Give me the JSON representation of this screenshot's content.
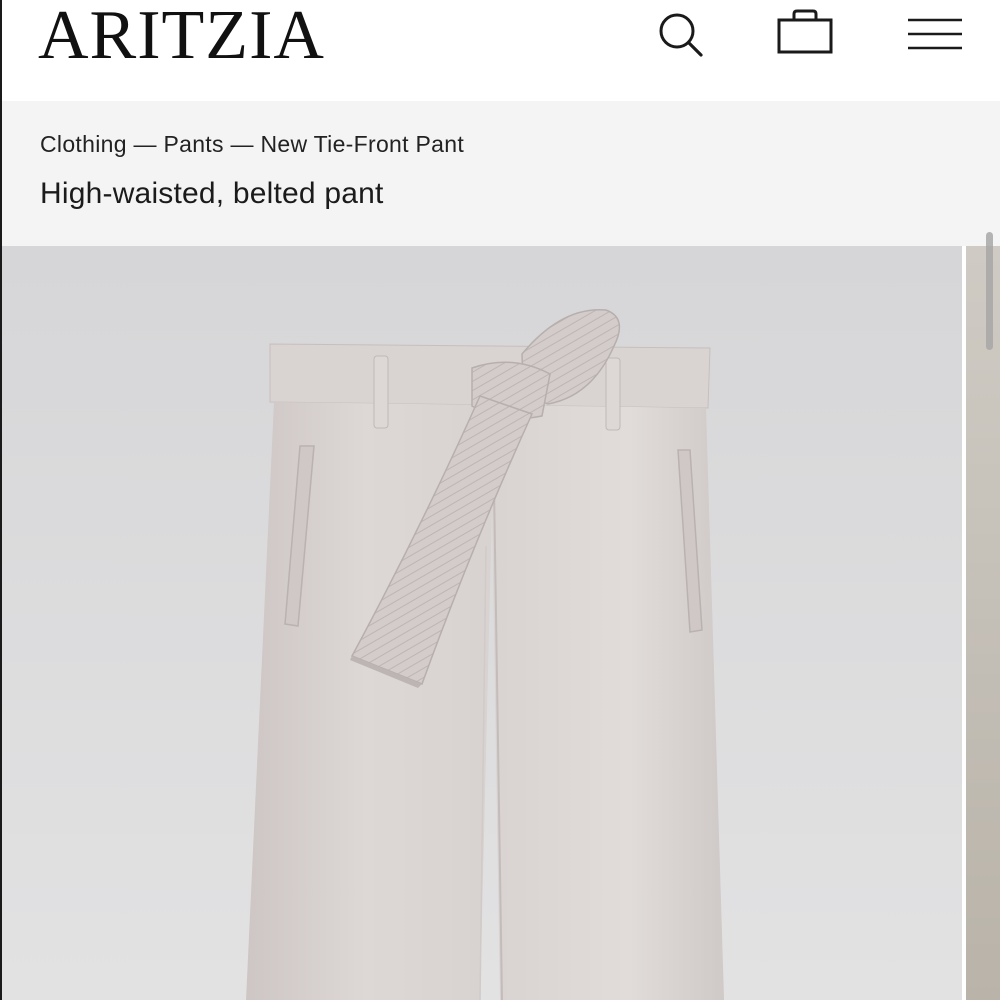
{
  "brand": {
    "logo_text": "ARITZIA"
  },
  "header": {
    "icons": [
      "search-icon",
      "bag-icon",
      "menu-icon"
    ]
  },
  "breadcrumb": {
    "items": [
      "Clothing",
      "Pants",
      "New Tie-Front Pant"
    ],
    "separator": " — "
  },
  "product": {
    "subtitle": "High-waisted, belted pant",
    "color_hex": "#d9d4d2"
  }
}
